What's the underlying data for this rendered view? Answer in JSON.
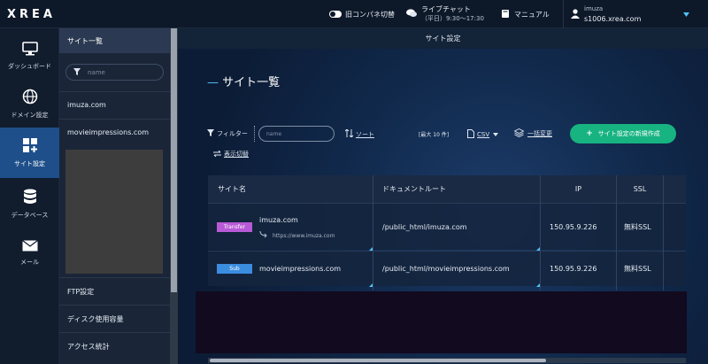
{
  "topbar": {
    "logo": "XREA",
    "toggle_label": "旧コンパネ切替",
    "chat_label": "ライブチャット",
    "chat_hours": "（平日）9:30〜17:30",
    "manual_label": "マニュアル",
    "user_name": "imuza",
    "user_server": "s1006.xrea.com"
  },
  "left_nav": {
    "items": [
      {
        "label": "ダッシュボード",
        "icon": "monitor-icon"
      },
      {
        "label": "ドメイン設定",
        "icon": "globe-icon"
      },
      {
        "label": "サイト設定",
        "icon": "site-grid-icon",
        "active": true
      },
      {
        "label": "データベース",
        "icon": "database-icon"
      },
      {
        "label": "メール",
        "icon": "mail-icon"
      }
    ]
  },
  "sub_nav": {
    "header": "サイト一覧",
    "search_placeholder": "name",
    "sites": [
      "imuza.com",
      "movieimpressions.com"
    ],
    "bottom_links": [
      "FTP設定",
      "ディスク使用容量",
      "アクセス統計"
    ]
  },
  "main": {
    "breadcrumb": "サイト設定",
    "title": "サイト一覧",
    "title_dash": "—",
    "filter_label": "フィルター",
    "filter_placeholder": "name",
    "sort_label": "ソート",
    "toggle_view_label": "表示切替",
    "max_label": "[最大 10 件]",
    "csv_label": "CSV",
    "bulk_label": "一括変更",
    "create_button": "サイト設定の新規作成",
    "columns": [
      "サイト名",
      "ドキュメントルート",
      "IP",
      "SSL"
    ],
    "rows": [
      {
        "badge": "Transfer",
        "badge_color": "#b85ad6",
        "name": "imuza.com",
        "redirect": "https://www.imuza.com",
        "docroot": "/public_html/imuza.com",
        "ip": "150.95.9.226",
        "ssl": "無料SSL"
      },
      {
        "badge": "Sub",
        "badge_color": "#3b8de0",
        "name": "movieimpressions.com",
        "redirect": "",
        "docroot": "/public_html/movieimpressions.com",
        "ip": "150.95.9.226",
        "ssl": "無料SSL"
      }
    ]
  }
}
